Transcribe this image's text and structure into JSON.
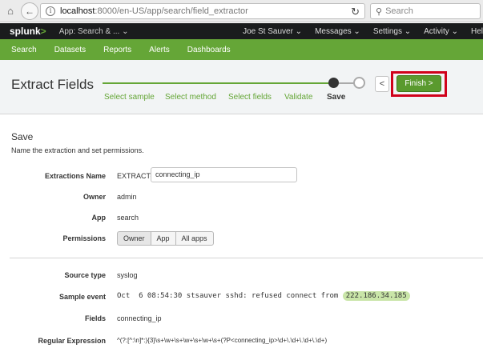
{
  "browser": {
    "url_host": "localhost",
    "url_path": ":8000/en-US/app/search/field_extractor",
    "search_placeholder": "Search"
  },
  "splunk_header": {
    "logo": "splunk",
    "logo_mark": ">",
    "app_menu": "App: Search & ...",
    "nav": [
      "Joe St Sauver",
      "Messages",
      "Settings",
      "Activity",
      "Hel"
    ]
  },
  "app_nav": [
    "Search",
    "Datasets",
    "Reports",
    "Alerts",
    "Dashboards"
  ],
  "extract": {
    "title": "Extract Fields",
    "steps": [
      "Select sample",
      "Select method",
      "Select fields",
      "Validate",
      "Save"
    ],
    "active_step": "Save",
    "prev_label": "<",
    "finish_label": "Finish >"
  },
  "save": {
    "title": "Save",
    "description": "Name the extraction and set permissions.",
    "extractions_name_label": "Extractions Name",
    "extractions_prefix": "EXTRACT-",
    "extractions_value": "connecting_ip",
    "owner_label": "Owner",
    "owner_value": "admin",
    "app_label": "App",
    "app_value": "search",
    "permissions_label": "Permissions",
    "permissions_options": [
      "Owner",
      "App",
      "All apps"
    ],
    "permissions_selected": "Owner",
    "source_type_label": "Source type",
    "source_type_value": "syslog",
    "sample_event_label": "Sample event",
    "sample_event_text": "Oct  6 08:54:30 stsauver sshd: refused connect from ",
    "sample_event_highlight": "222.186.34.185",
    "fields_label": "Fields",
    "fields_value": "connecting_ip",
    "regex_label": "Regular Expression",
    "regex_value": "^(?:[^:\\n]*:){3}\\s+\\w+\\s+\\w+\\s+\\w+\\s+(?P<connecting_ip>\\d+\\.\\d+\\.\\d+\\.\\d+)"
  }
}
